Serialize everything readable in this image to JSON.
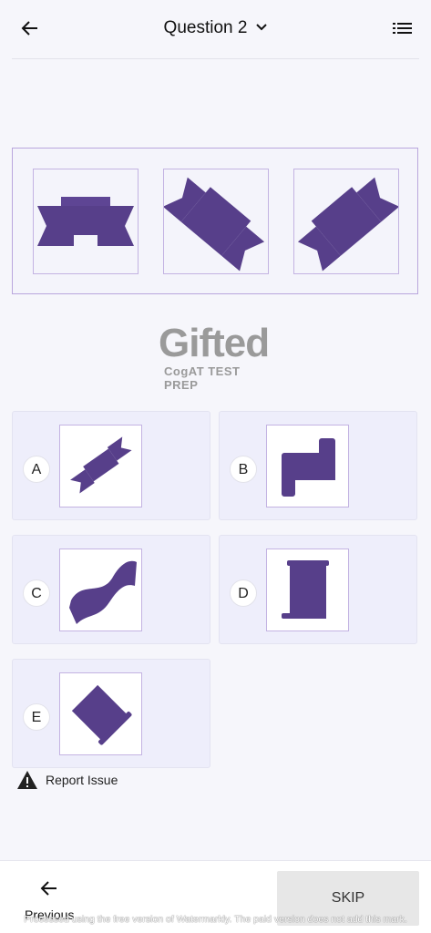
{
  "header": {
    "title": "Question 2",
    "icons": {
      "back": "arrow-left-icon",
      "dropdown": "chevron-down-icon",
      "list": "list-icon"
    }
  },
  "question": {
    "figures": [
      "ribbon-banner-figure",
      "ribbon-banner-figure-rotated-right",
      "ribbon-banner-figure-rotated-left"
    ]
  },
  "logo": {
    "word": "Gifted",
    "tagline": "CogAT TEST PREP"
  },
  "answers": [
    {
      "letter": "A",
      "figure": "ribbon-banner-small-figure"
    },
    {
      "letter": "B",
      "figure": "bracket-shape-figure"
    },
    {
      "letter": "C",
      "figure": "wavy-ribbon-figure"
    },
    {
      "letter": "D",
      "figure": "scroll-figure"
    },
    {
      "letter": "E",
      "figure": "rotated-scroll-figure"
    }
  ],
  "report": {
    "label": "Report Issue",
    "icon": "warning-icon"
  },
  "footer": {
    "previous_label": "Previous",
    "skip_label": "SKIP",
    "watermark": "Processed using the free version of Watermarkly. The paid version does not add this mark."
  },
  "colors": {
    "shape": "#573f8a",
    "tile_border": "#c3b3e2",
    "answer_bg": "#eeeefb"
  }
}
